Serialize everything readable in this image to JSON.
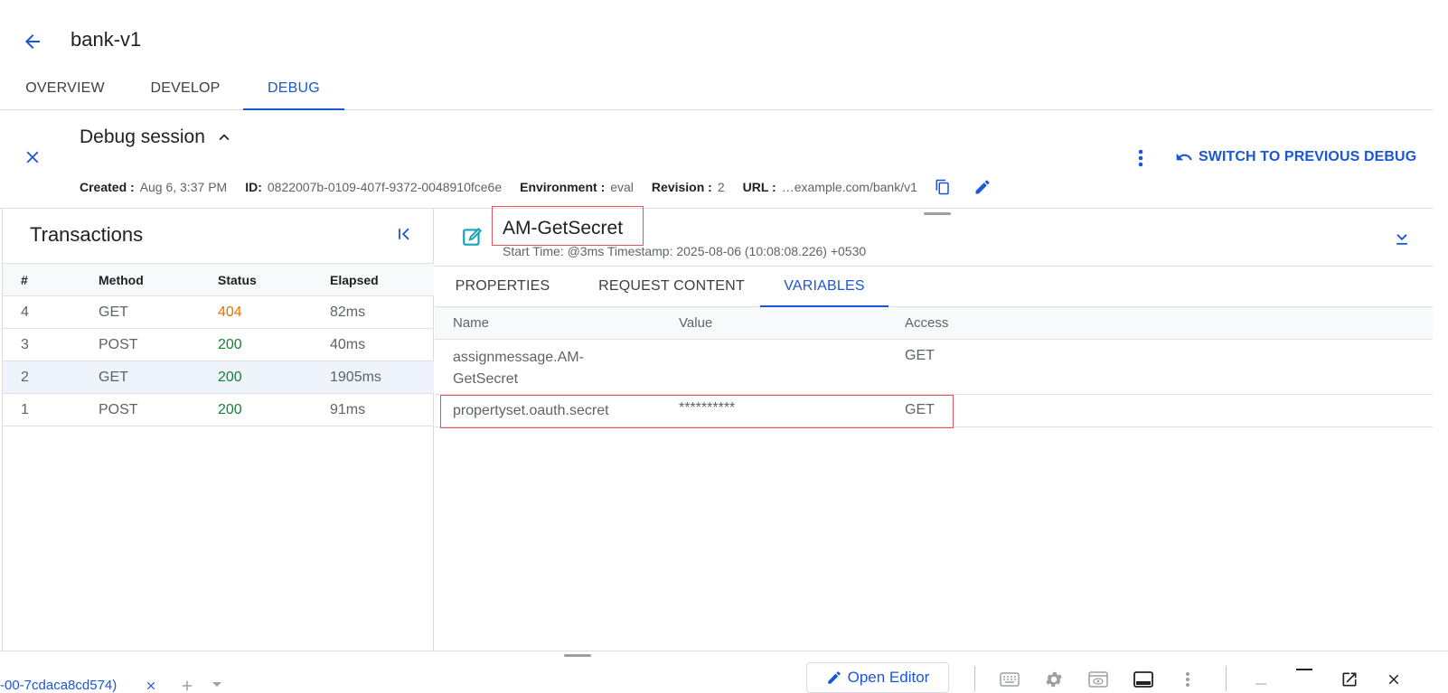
{
  "header": {
    "title": "bank-v1"
  },
  "tabs": [
    {
      "label": "OVERVIEW",
      "active": false
    },
    {
      "label": "DEVELOP",
      "active": false
    },
    {
      "label": "DEBUG",
      "active": true
    }
  ],
  "session": {
    "title": "Debug session",
    "meta": {
      "created_label": "Created :",
      "created": "Aug 6, 3:37 PM",
      "id_label": "ID:",
      "id": "0822007b-0109-407f-9372-0048910fce6e",
      "env_label": "Environment :",
      "env": "eval",
      "rev_label": "Revision :",
      "rev": "2",
      "url_label": "URL :",
      "url": "…example.com/bank/v1"
    },
    "switch_label": "SWITCH TO PREVIOUS DEBUG"
  },
  "transactions": {
    "title": "Transactions",
    "headers": [
      "#",
      "Method",
      "Status",
      "Elapsed"
    ],
    "rows": [
      {
        "num": "4",
        "method": "GET",
        "status": "404",
        "elapsed": "82ms"
      },
      {
        "num": "3",
        "method": "POST",
        "status": "200",
        "elapsed": "40ms"
      },
      {
        "num": "2",
        "method": "GET",
        "status": "200",
        "elapsed": "1905ms"
      },
      {
        "num": "1",
        "method": "POST",
        "status": "200",
        "elapsed": "91ms"
      }
    ]
  },
  "policy": {
    "name": "AM-GetSecret",
    "time": "Start Time: @3ms Timestamp: 2025-08-06 (10:08:08.226) +0530"
  },
  "sub_tabs": [
    {
      "label": "PROPERTIES"
    },
    {
      "label": "REQUEST CONTENT"
    },
    {
      "label": "VARIABLES"
    }
  ],
  "variables": {
    "headers": {
      "name": "Name",
      "value": "Value",
      "access": "Access"
    },
    "rows": [
      {
        "name_line1": "assignmessage.AM-",
        "name_line2": "GetSecret",
        "value": "",
        "access": "GET"
      },
      {
        "name": "propertyset.oauth.secret",
        "value": "**********",
        "access": "GET"
      }
    ]
  },
  "bottom": {
    "tab_label": "-00-7cdaca8cd574)",
    "open_editor": "Open Editor"
  },
  "colors": {
    "accent": "#1a57d6",
    "highlight": "#e25462",
    "status_ok": "#188038",
    "status_warn": "#e37400"
  }
}
